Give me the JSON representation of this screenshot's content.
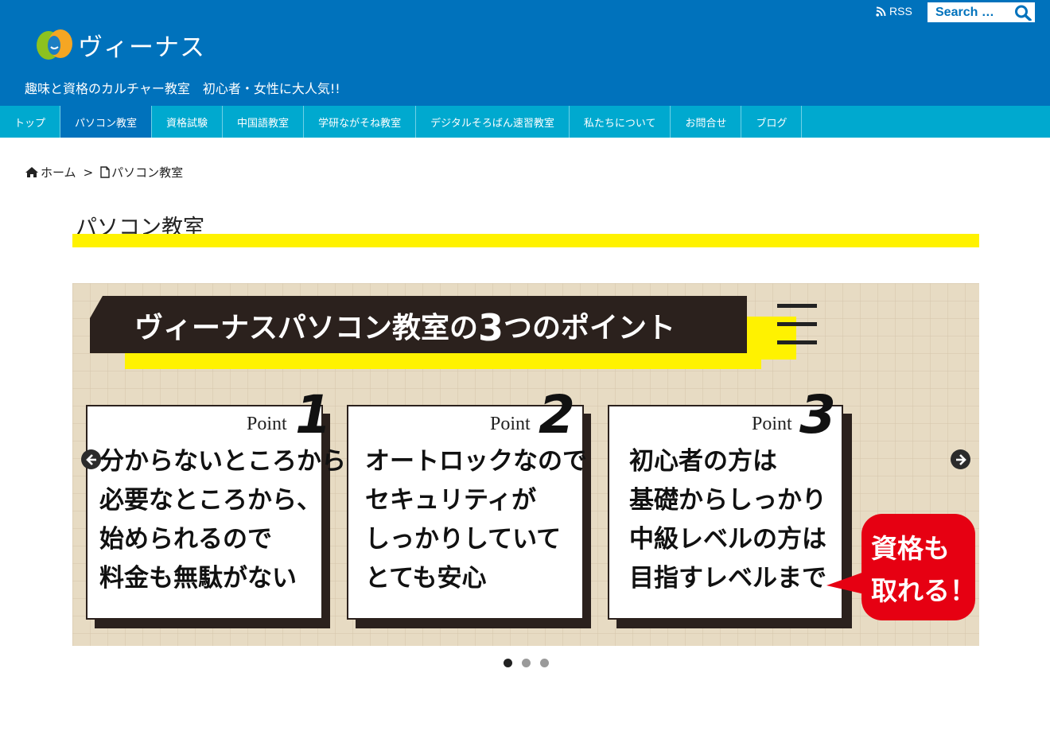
{
  "site": {
    "name": "ヴィーナス",
    "tagline": "趣味と資格のカルチャー教室　初心者・女性に大人気!!"
  },
  "header": {
    "rss_label": "RSS",
    "search_placeholder": "Search …"
  },
  "nav": {
    "items": [
      {
        "label": "トップ",
        "active": false
      },
      {
        "label": "パソコン教室",
        "active": true
      },
      {
        "label": "資格試験",
        "active": false
      },
      {
        "label": "中国語教室",
        "active": false
      },
      {
        "label": "学研ながそね教室",
        "active": false
      },
      {
        "label": "デジタルそろばん速習教室",
        "active": false
      },
      {
        "label": "私たちについて",
        "active": false
      },
      {
        "label": "お問合せ",
        "active": false
      },
      {
        "label": "ブログ",
        "active": false
      }
    ]
  },
  "breadcrumb": {
    "home": "ホーム",
    "separator": ">",
    "current": "パソコン教室"
  },
  "page": {
    "title": "パソコン教室"
  },
  "slide": {
    "heading_a": "ヴィーナスパソコン教室の",
    "heading_num": "3",
    "heading_b": "つのポイント",
    "point_label": "Point",
    "cards": [
      {
        "num": "1",
        "lines": [
          "分からないところから、",
          "必要なところから、",
          "始められるので",
          "料金も無駄がない"
        ]
      },
      {
        "num": "2",
        "lines": [
          "オートロックなので",
          "セキュリティが",
          "しっかりしていて",
          "とても安心"
        ]
      },
      {
        "num": "3",
        "lines": [
          "初心者の方は",
          "基礎からしっかり",
          "中級レベルの方は",
          "目指すレベルまで"
        ]
      }
    ],
    "bubble_lines": [
      "資格も",
      "取れる！"
    ]
  },
  "slider": {
    "dot_count": 3,
    "active_index": 0
  },
  "colors": {
    "header_blue": "#0072bc",
    "nav_cyan": "#00a9cf",
    "title_yellow": "#fff200",
    "bubble_red": "#e60012"
  }
}
